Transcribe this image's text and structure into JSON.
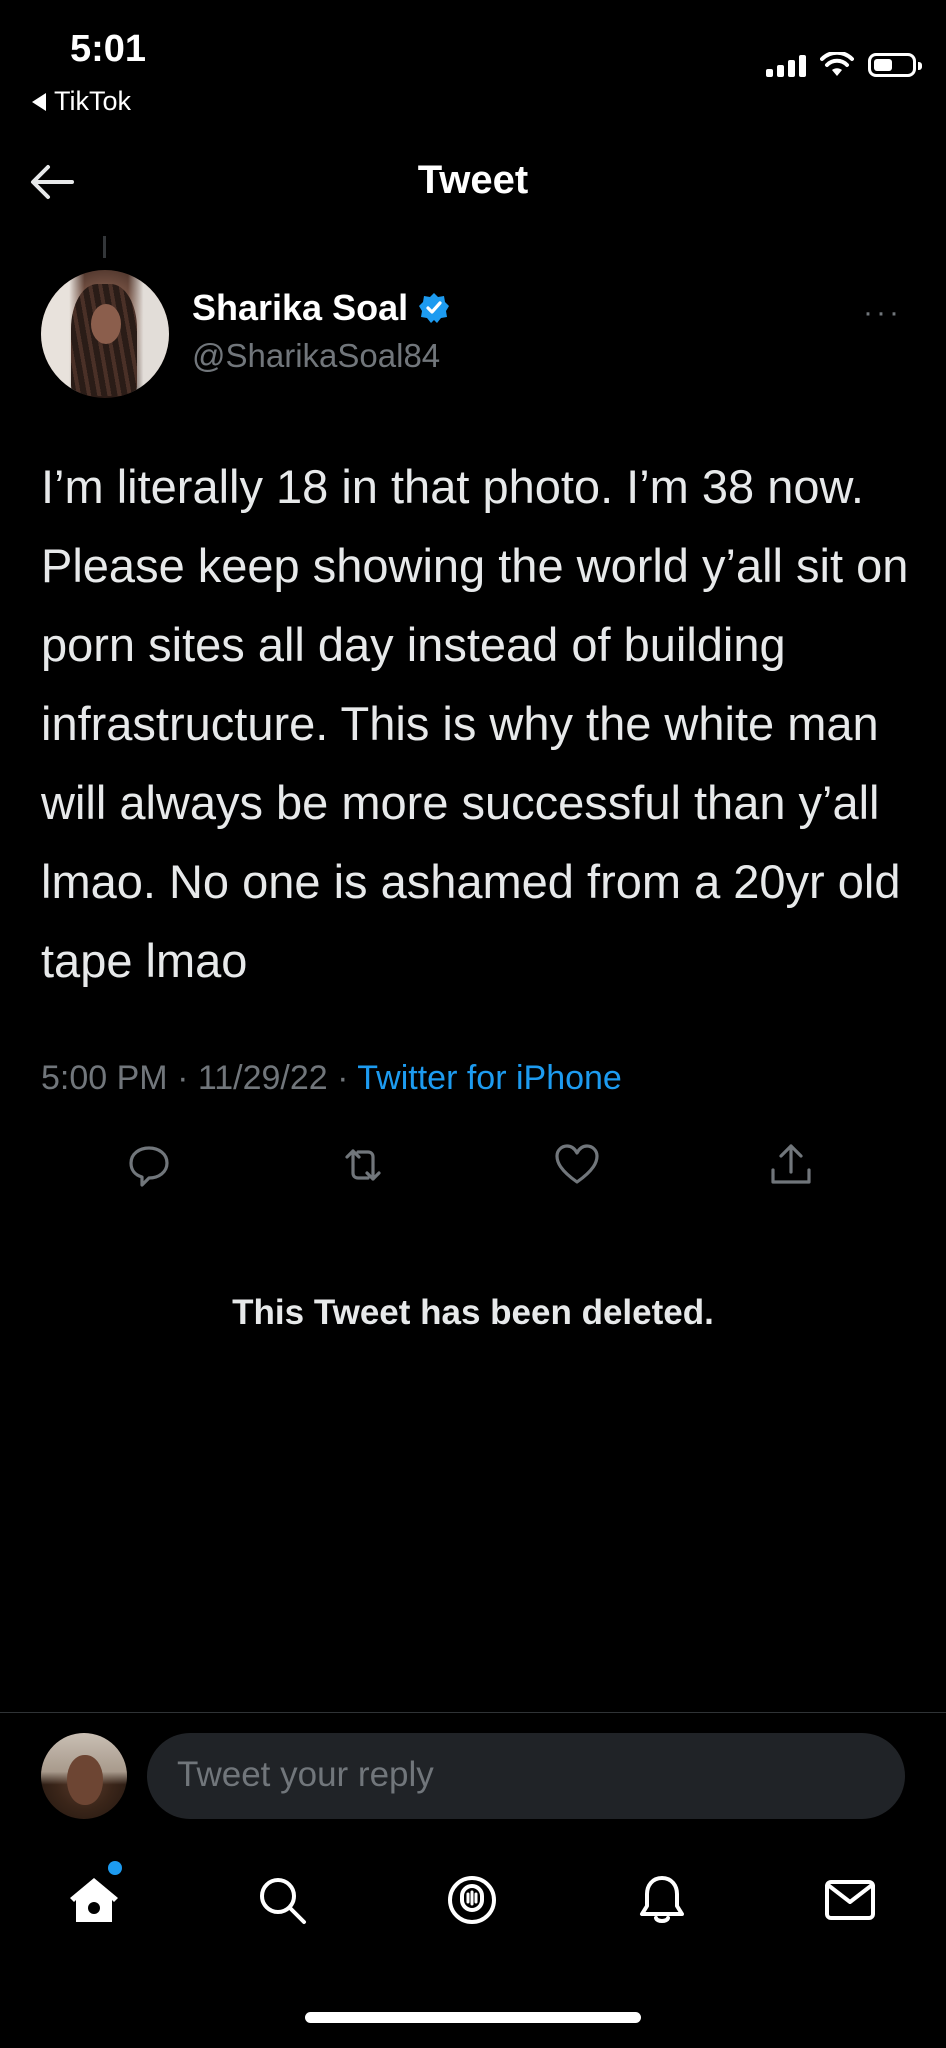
{
  "status_bar": {
    "time": "5:01",
    "back_app": "TikTok"
  },
  "header": {
    "title": "Tweet",
    "back_icon": "arrow-left-icon"
  },
  "tweet": {
    "author_name": "Sharika Soal",
    "author_handle": "@SharikaSoal84",
    "verified": true,
    "more": "···",
    "text": "I’m literally 18 in that photo. I’m 38 now. Please keep showing the world y’all sit on porn sites all day instead of building infrastructure. This is why the white man will always be more successful than y’all lmao. No one is ashamed from a 20yr old tape lmao",
    "time": "5:00 PM",
    "date": "11/29/22",
    "source": "Twitter for iPhone",
    "separator": " · "
  },
  "actions": [
    "reply-icon",
    "retweet-icon",
    "like-icon",
    "share-icon"
  ],
  "deleted_notice": "This Tweet has been deleted.",
  "reply": {
    "placeholder": "Tweet your reply"
  },
  "tab_bar": [
    "home-icon",
    "search-icon",
    "spaces-icon",
    "notifications-icon",
    "messages-icon"
  ],
  "colors": {
    "background": "#000000",
    "accent": "#1d9bf0",
    "secondary_text": "#71767b"
  }
}
